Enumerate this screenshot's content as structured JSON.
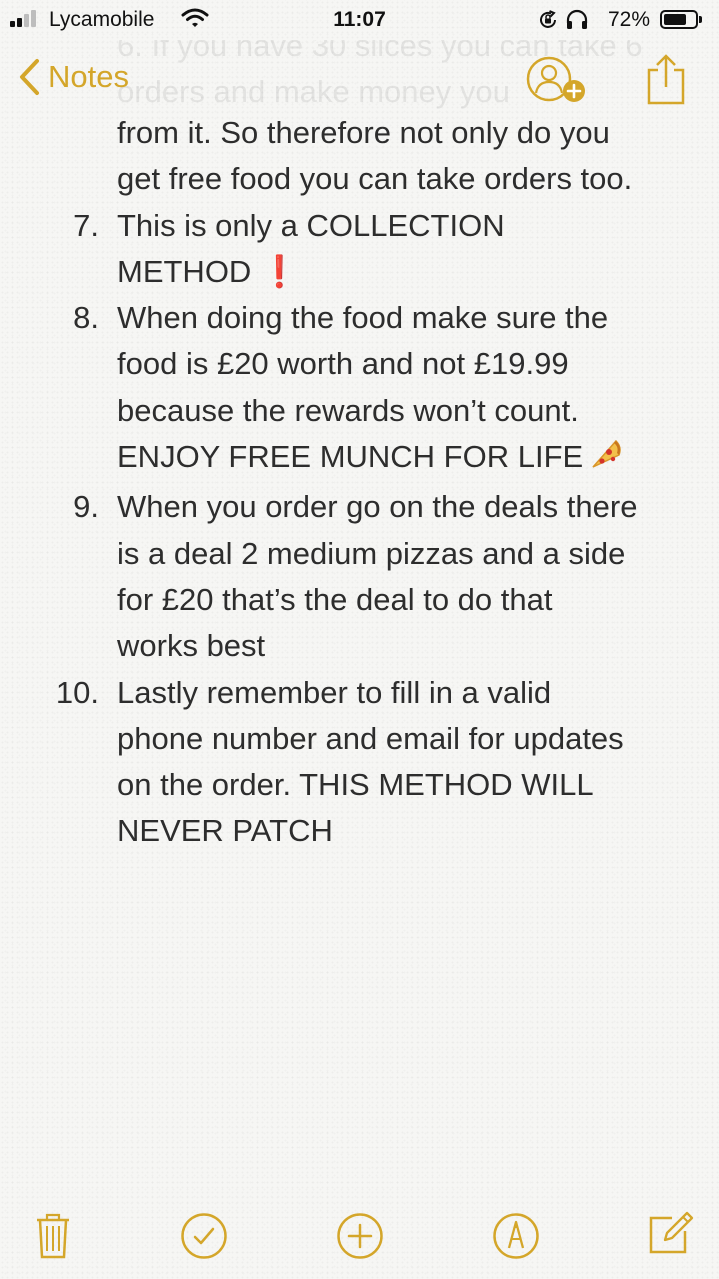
{
  "status_bar": {
    "carrier": "Lycamobile",
    "time": "11:07",
    "battery_percent_text": "72%",
    "battery_level": 0.72,
    "signal_bars_filled": 2,
    "signal_bars_total": 4,
    "icons": [
      "signal-icon",
      "wifi-icon",
      "rotation-lock-icon",
      "headphones-icon",
      "battery-icon"
    ]
  },
  "nav": {
    "back_label": "Notes",
    "ghost_lines": [
      "6. If you have 30 slices you can take 6",
      "orders and make money you"
    ],
    "icons": [
      "chevron-left-icon",
      "add-people-icon",
      "share-icon"
    ]
  },
  "note": {
    "continuation": [
      "from it. So therefore not only do you",
      "get free food you can take orders too."
    ],
    "items": [
      {
        "num": "7.",
        "lines": [
          "This is only a COLLECTION",
          "METHOD"
        ],
        "suffix": "❗"
      },
      {
        "num": "8.",
        "lines": [
          "When doing the food make sure the",
          "food is £20 worth and not £19.99",
          "because the rewards won’t count.",
          "ENJOY FREE MUNCH FOR LIFE"
        ],
        "suffix": "pizza-icon"
      },
      {
        "num": "9.",
        "lines": [
          "When you order go on the deals there",
          "is a deal 2 medium pizzas and a side",
          "for £20 that’s the deal to do that",
          "works best"
        ]
      },
      {
        "num": "10.",
        "lines": [
          "Lastly remember to fill in a valid",
          "phone number and email for updates",
          "on the order. THIS METHOD WILL",
          "NEVER PATCH"
        ]
      }
    ]
  },
  "toolbar": {
    "icons": [
      "trash-icon",
      "checklist-icon",
      "add-icon",
      "markup-icon",
      "compose-icon"
    ]
  },
  "colors": {
    "accent": "#d4a62a",
    "text": "#2d2d2d",
    "background": "#f6f6f4",
    "exclamation": "#e0201c"
  }
}
